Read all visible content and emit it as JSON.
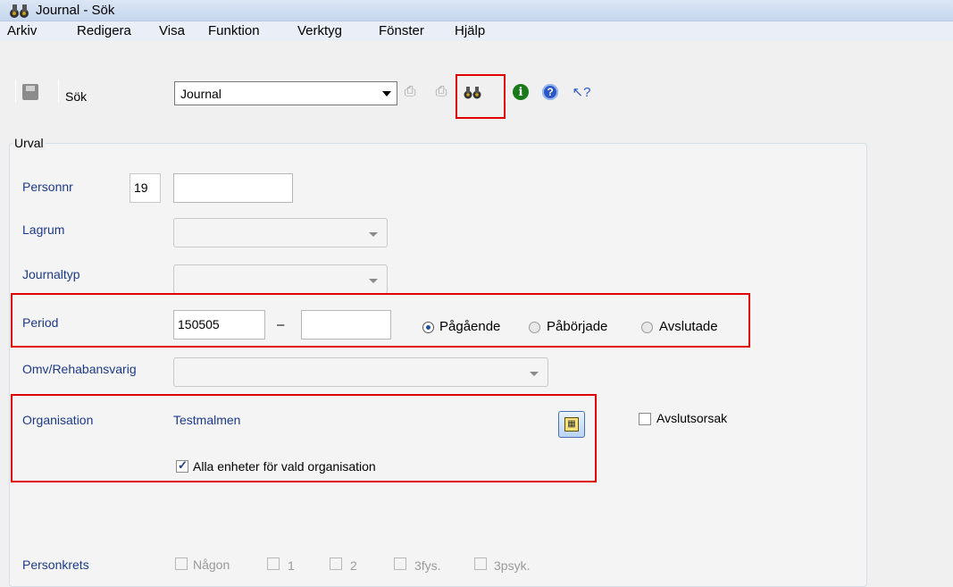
{
  "window": {
    "title": "Journal - Sök",
    "app_icon": "binoculars-icon"
  },
  "menu": [
    "Arkiv",
    "Redigera",
    "Visa",
    "Funktion",
    "Verktyg",
    "Fönster",
    "Hjälp"
  ],
  "toolbar": {
    "search_label": "Sök",
    "search_type_value": "Journal",
    "icons": [
      "save-icon",
      "print-icon",
      "print-preview-icon",
      "search-binoculars-icon",
      "info-icon",
      "help-icon",
      "whats-this-icon"
    ]
  },
  "form": {
    "group_title": "Urval",
    "personnr": {
      "label": "Personnr",
      "prefix": "19",
      "value": ""
    },
    "lagrum": {
      "label": "Lagrum",
      "value": ""
    },
    "journaltyp": {
      "label": "Journaltyp",
      "value": ""
    },
    "period": {
      "label": "Period",
      "from": "150505",
      "dash": "–",
      "to": "",
      "options": [
        "Pågående",
        "Påbörjade",
        "Avslutade"
      ],
      "selected": "Pågående"
    },
    "omv": {
      "label": "Omv/Rehabansvarig",
      "value": ""
    },
    "organisation": {
      "label": "Organisation",
      "value": "Testmalmen",
      "all_units_label": "Alla enheter för vald organisation",
      "all_units_checked": true
    },
    "avslutsorsak": {
      "label": "Avslutsorsak",
      "checked": false
    },
    "personkrets": {
      "label": "Personkrets",
      "options": [
        "Någon",
        "1",
        "2",
        "3fys.",
        "3psyk."
      ]
    }
  },
  "colors": {
    "highlight": "#e00000",
    "label_blue": "#1b3a8a"
  }
}
